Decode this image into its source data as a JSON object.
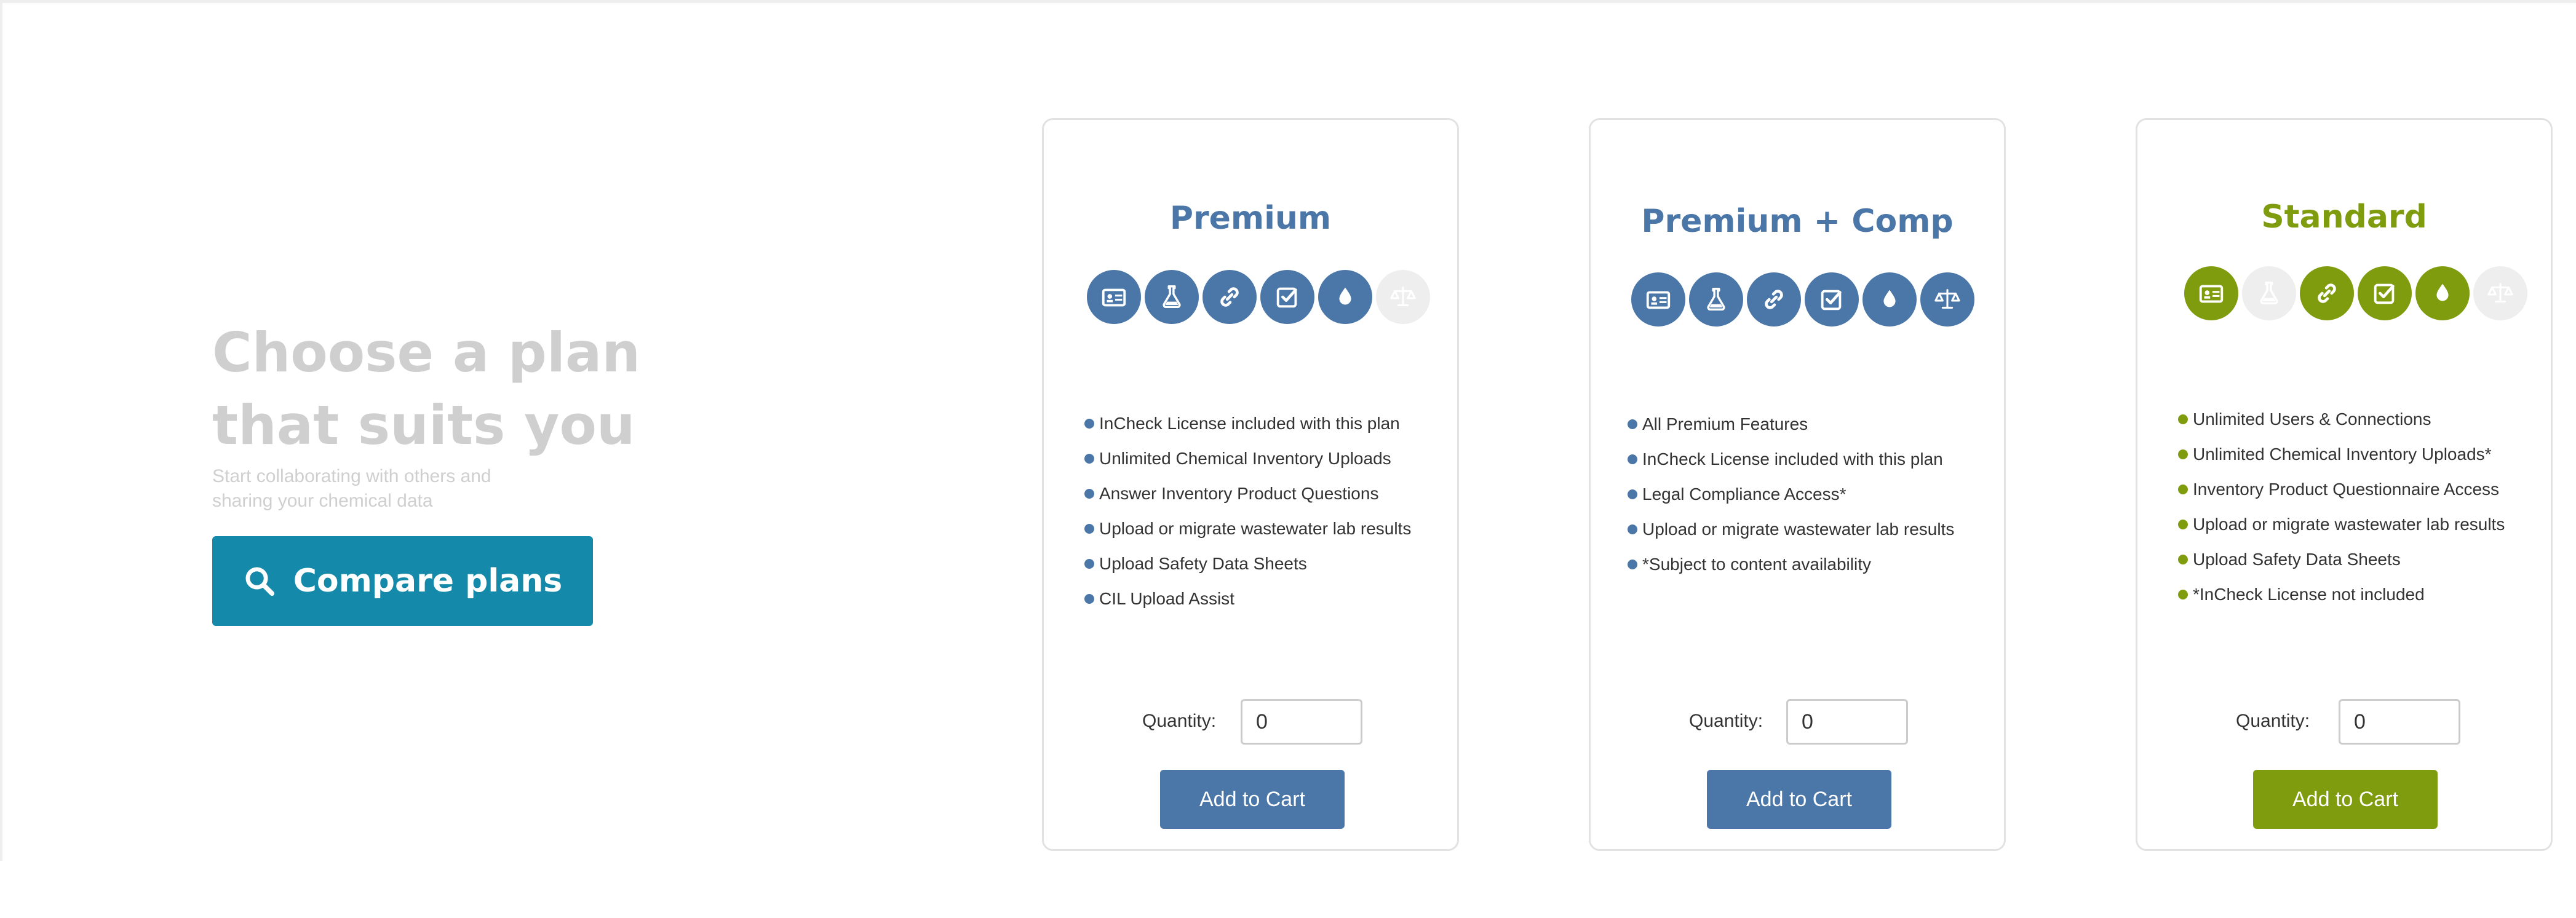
{
  "colors": {
    "blue": "#4a76a8",
    "green": "#7f9c0f",
    "teal": "#1589a9",
    "disabled": "#eeeeee",
    "hero_text": "#cfcfcf"
  },
  "hero": {
    "title_line1": "Choose a plan",
    "title_line2": "that suits you",
    "subtitle_line1": "Start collaborating with others and",
    "subtitle_line2": "sharing your chemical data",
    "compare_button": "Compare plans",
    "compare_icon": "search-icon"
  },
  "plans": [
    {
      "name": "Premium",
      "color": "#4a76a8",
      "icons": [
        {
          "name": "id-card-icon",
          "active": true
        },
        {
          "name": "flask-icon",
          "active": true
        },
        {
          "name": "link-icon",
          "active": true
        },
        {
          "name": "checkbox-icon",
          "active": true
        },
        {
          "name": "drop-icon",
          "active": true
        },
        {
          "name": "scale-icon",
          "active": false
        }
      ],
      "features": [
        "InCheck License included with this plan",
        "Unlimited Chemical Inventory Uploads",
        "Answer Inventory Product Questions",
        "Upload or migrate wastewater lab results",
        "Upload Safety Data Sheets",
        "CIL Upload Assist"
      ],
      "quantity_label": "Quantity:",
      "quantity_value": "0",
      "add_to_cart": "Add to Cart"
    },
    {
      "name": "Premium + Comp",
      "color": "#4a76a8",
      "icons": [
        {
          "name": "id-card-icon",
          "active": true
        },
        {
          "name": "flask-icon",
          "active": true
        },
        {
          "name": "link-icon",
          "active": true
        },
        {
          "name": "checkbox-icon",
          "active": true
        },
        {
          "name": "drop-icon",
          "active": true
        },
        {
          "name": "scale-icon",
          "active": true
        }
      ],
      "features": [
        "All Premium Features",
        "InCheck License included with this plan",
        "Legal Compliance Access*",
        "Upload or migrate wastewater lab results",
        "*Subject to content availability"
      ],
      "quantity_label": "Quantity:",
      "quantity_value": "0",
      "add_to_cart": "Add to Cart"
    },
    {
      "name": "Standard",
      "color": "#7f9c0f",
      "icons": [
        {
          "name": "id-card-icon",
          "active": true
        },
        {
          "name": "flask-icon",
          "active": false
        },
        {
          "name": "link-icon",
          "active": true
        },
        {
          "name": "checkbox-icon",
          "active": true
        },
        {
          "name": "drop-icon",
          "active": true
        },
        {
          "name": "scale-icon",
          "active": false
        }
      ],
      "features": [
        "Unlimited Users & Connections",
        "Unlimited Chemical Inventory Uploads*",
        "Inventory Product Questionnaire Access",
        "Upload or migrate wastewater lab results",
        "Upload Safety Data Sheets",
        "*InCheck License not included"
      ],
      "quantity_label": "Quantity:",
      "quantity_value": "0",
      "add_to_cart": "Add to Cart"
    }
  ]
}
